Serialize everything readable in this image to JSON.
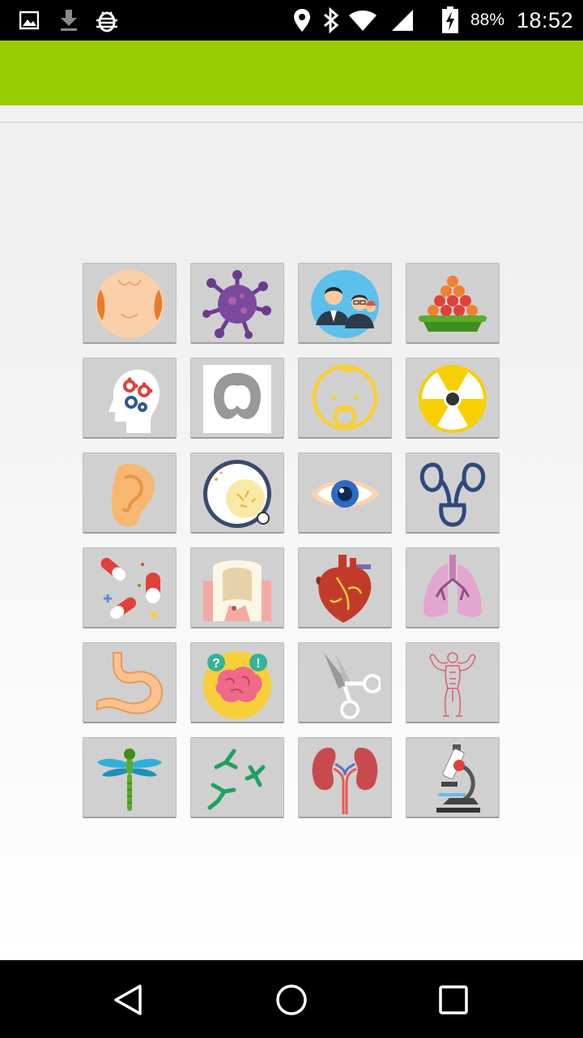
{
  "status_bar": {
    "battery_text": "88%",
    "time": "18:52",
    "icons": [
      "image-notification-icon",
      "download-notification-icon",
      "bug-notification-icon",
      "location-icon",
      "bluetooth-icon",
      "wifi-icon",
      "signal-icon",
      "battery-charging-icon"
    ]
  },
  "theme": {
    "accent": "#99cc00"
  },
  "grid": {
    "columns": 4,
    "tiles": [
      {
        "icon": "skin-icon"
      },
      {
        "icon": "virus-icon"
      },
      {
        "icon": "people-icon"
      },
      {
        "icon": "bowl-of-fruit-icon"
      },
      {
        "icon": "mind-gears-icon"
      },
      {
        "icon": "thyroid-icon"
      },
      {
        "icon": "baby-pacifier-icon"
      },
      {
        "icon": "radiation-icon"
      },
      {
        "icon": "ear-icon"
      },
      {
        "icon": "petri-dish-icon"
      },
      {
        "icon": "eye-icon"
      },
      {
        "icon": "urinary-system-icon"
      },
      {
        "icon": "pills-icon"
      },
      {
        "icon": "tooth-icon"
      },
      {
        "icon": "heart-icon"
      },
      {
        "icon": "lungs-icon"
      },
      {
        "icon": "stomach-icon"
      },
      {
        "icon": "brain-question-icon"
      },
      {
        "icon": "scissors-icon"
      },
      {
        "icon": "muscle-body-icon"
      },
      {
        "icon": "dragonfly-icon"
      },
      {
        "icon": "neuron-branches-icon"
      },
      {
        "icon": "kidneys-icon"
      },
      {
        "icon": "microscope-icon"
      }
    ]
  },
  "nav_bar": {
    "buttons": [
      "back-button",
      "home-button",
      "recents-button"
    ]
  }
}
